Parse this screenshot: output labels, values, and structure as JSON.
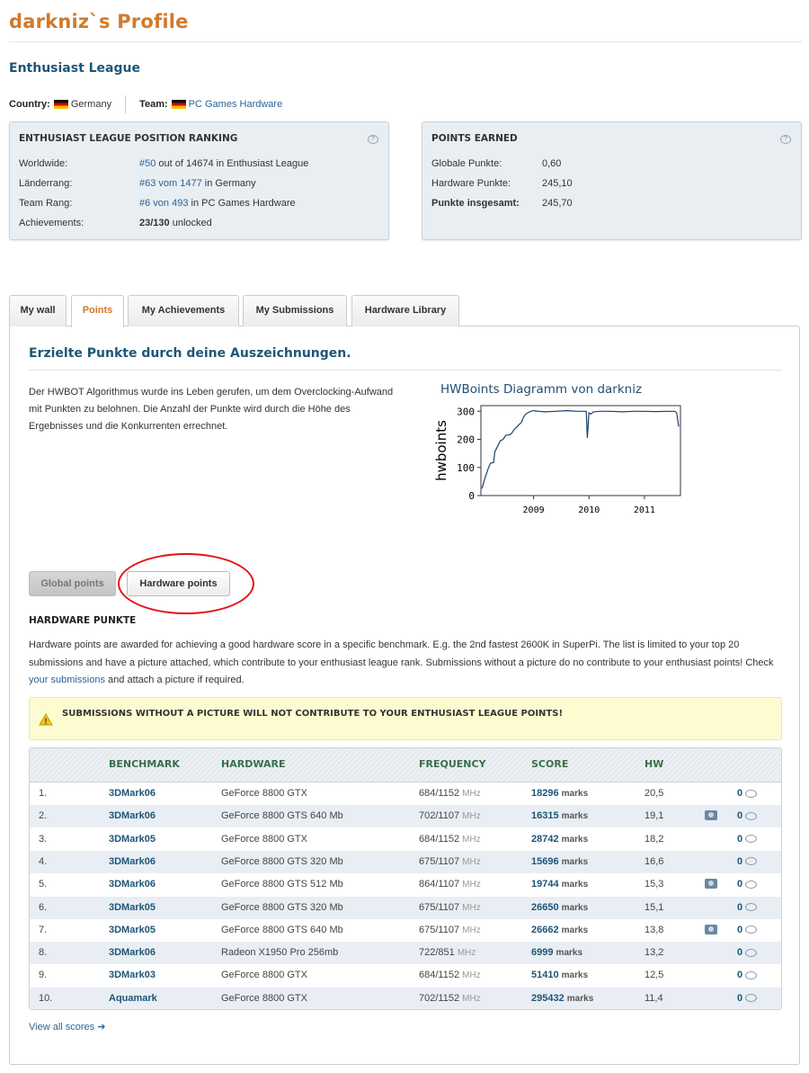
{
  "header": {
    "title": "darkniz`s Profile",
    "league_title": "Enthusiast League"
  },
  "country": {
    "label": "Country:",
    "value": "Germany",
    "team_label": "Team:",
    "team_value": "PC Games Hardware"
  },
  "ranking": {
    "title": "ENTHUSIAST LEAGUE POSITION RANKING",
    "rows": [
      {
        "label": "Worldwide:",
        "link": "#50",
        "rest": " out of 14674 in Enthusiast League"
      },
      {
        "label": "Länderrang:",
        "link": "#63 vom 1477",
        "rest": " in Germany"
      },
      {
        "label": "Team Rang:",
        "link": "#6 von 493",
        "rest": " in PC Games Hardware"
      },
      {
        "label": "Achievements:",
        "strong": "23/130",
        "rest": " unlocked"
      }
    ]
  },
  "points": {
    "title": "POINTS EARNED",
    "rows": [
      {
        "label": "Globale Punkte:",
        "value": "0,60"
      },
      {
        "label": "Hardware Punkte:",
        "value": "245,10"
      },
      {
        "label": "Punkte insgesamt:",
        "value": "245,70"
      }
    ]
  },
  "tabs": [
    "My wall",
    "Points",
    "My Achievements",
    "My Submissions",
    "Hardware Library"
  ],
  "section": {
    "title": "Erzielte Punkte durch deine Auszeichnungen.",
    "intro": "Der HWBOT Algorithmus wurde ins Leben gerufen, um dem Overclocking-Aufwand mit Punkten zu belohnen. Die Anzahl der Punkte wird durch die Höhe des Ergebnisses und die Konkurrenten errechnet."
  },
  "chart_data": {
    "type": "line",
    "title": "HWBoints Diagramm von darkniz",
    "xlabel": "",
    "ylabel": "hwboints",
    "ylim": [
      0,
      320
    ],
    "yticks": [
      0,
      100,
      200,
      300
    ],
    "xticks": [
      "2009",
      "2010",
      "2011"
    ],
    "xlim": [
      2008.05,
      2011.65
    ],
    "series": [
      {
        "x": [
          2008.07,
          2008.12,
          2008.18,
          2008.22,
          2008.28,
          2008.3,
          2008.35,
          2008.4,
          2008.45,
          2008.5,
          2008.55,
          2008.6,
          2008.65,
          2008.7,
          2008.75,
          2008.78,
          2008.82,
          2008.86,
          2008.9,
          2008.95,
          2009.0,
          2009.1,
          2009.2,
          2009.4,
          2009.6,
          2009.8,
          2009.95,
          2009.97,
          2010.0,
          2010.03,
          2010.08,
          2010.2,
          2010.4,
          2010.6,
          2010.8,
          2011.0,
          2011.2,
          2011.4,
          2011.55,
          2011.58,
          2011.62
        ],
        "y": [
          25,
          60,
          95,
          115,
          118,
          155,
          175,
          195,
          200,
          215,
          215,
          220,
          235,
          245,
          255,
          260,
          280,
          290,
          295,
          300,
          302,
          300,
          298,
          300,
          302,
          300,
          300,
          205,
          295,
          290,
          298,
          300,
          300,
          298,
          300,
          300,
          299,
          300,
          300,
          295,
          245
        ]
      }
    ]
  },
  "buttons": {
    "global": "Global points",
    "hardware": "Hardware points"
  },
  "hardware": {
    "title": "HARDWARE PUNKTE",
    "text_1": "Hardware points are awarded for achieving a good hardware score in a specific benchmark. E.g. the 2nd fastest 2600K in SuperPi. The list is limited to your top 20 submissions and have a picture attached, which contribute to your enthusiast league rank. Submissions without a picture do no contribute to your enthusiast points! Check ",
    "text_link": "your submissions",
    "text_2": " and attach a picture if required."
  },
  "warning": "SUBMISSIONS WITHOUT A PICTURE WILL NOT CONTRIBUTE TO YOUR ENTHUSIAST LEAGUE POINTS!",
  "table": {
    "headers": [
      "BENCHMARK",
      "HARDWARE",
      "FREQUENCY",
      "SCORE",
      "HW"
    ],
    "mhz": "MHz",
    "marks": "marks",
    "rows": [
      {
        "n": "1.",
        "bench": "3DMark06",
        "hw": "GeForce 8800 GTX",
        "freq": "684/1152",
        "score": "18296",
        "pts": "20,5",
        "pic": false,
        "comments": "0"
      },
      {
        "n": "2.",
        "bench": "3DMark06",
        "hw": "GeForce 8800 GTS 640 Mb",
        "freq": "702/1107",
        "score": "16315",
        "pts": "19,1",
        "pic": true,
        "comments": "0"
      },
      {
        "n": "3.",
        "bench": "3DMark05",
        "hw": "GeForce 8800 GTX",
        "freq": "684/1152",
        "score": "28742",
        "pts": "18,2",
        "pic": false,
        "comments": "0"
      },
      {
        "n": "4.",
        "bench": "3DMark06",
        "hw": "GeForce 8800 GTS 320 Mb",
        "freq": "675/1107",
        "score": "15696",
        "pts": "16,6",
        "pic": false,
        "comments": "0"
      },
      {
        "n": "5.",
        "bench": "3DMark06",
        "hw": "GeForce 8800 GTS 512 Mb",
        "freq": "864/1107",
        "score": "19744",
        "pts": "15,3",
        "pic": true,
        "comments": "0"
      },
      {
        "n": "6.",
        "bench": "3DMark05",
        "hw": "GeForce 8800 GTS 320 Mb",
        "freq": "675/1107",
        "score": "26650",
        "pts": "15,1",
        "pic": false,
        "comments": "0"
      },
      {
        "n": "7.",
        "bench": "3DMark05",
        "hw": "GeForce 8800 GTS 640 Mb",
        "freq": "675/1107",
        "score": "26662",
        "pts": "13,8",
        "pic": true,
        "comments": "0"
      },
      {
        "n": "8.",
        "bench": "3DMark06",
        "hw": "Radeon X1950 Pro 256mb",
        "freq": "722/851",
        "score": "6999",
        "pts": "13,2",
        "pic": false,
        "comments": "0"
      },
      {
        "n": "9.",
        "bench": "3DMark03",
        "hw": "GeForce 8800 GTX",
        "freq": "684/1152",
        "score": "51410",
        "pts": "12,5",
        "pic": false,
        "comments": "0"
      },
      {
        "n": "10.",
        "bench": "Aquamark",
        "hw": "GeForce 8800 GTX",
        "freq": "702/1152",
        "score": "295432",
        "pts": "11,4",
        "pic": false,
        "comments": "0"
      }
    ]
  },
  "view_all": "View all scores ➔"
}
